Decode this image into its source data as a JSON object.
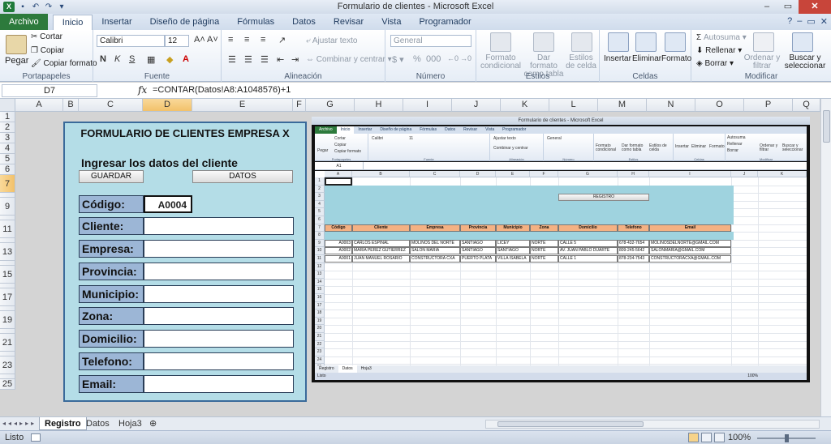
{
  "window": {
    "title": "Formulario de clientes - Microsoft Excel",
    "app_icon": "X"
  },
  "ribbon_tabs": [
    "Archivo",
    "Inicio",
    "Insertar",
    "Diseño de página",
    "Fórmulas",
    "Datos",
    "Revisar",
    "Vista",
    "Programador"
  ],
  "ribbon": {
    "clipboard": {
      "paste": "Pegar",
      "cut": "Cortar",
      "copy": "Copiar",
      "format_painter": "Copiar formato",
      "label": "Portapapeles"
    },
    "font": {
      "name": "Calibri",
      "size": "12",
      "bold": "N",
      "italic": "K",
      "underline": "S",
      "label": "Fuente"
    },
    "alignment": {
      "wrap": "Ajustar texto",
      "merge": "Combinar y centrar",
      "label": "Alineación"
    },
    "number": {
      "format": "General",
      "label": "Número"
    },
    "styles": {
      "conditional": "Formato condicional",
      "as_table": "Dar formato como tabla",
      "cell_styles": "Estilos de celda",
      "label": "Estilos"
    },
    "cells": {
      "insert": "Insertar",
      "delete": "Eliminar",
      "format": "Formato",
      "label": "Celdas"
    },
    "editing": {
      "autosum": "Autosuma",
      "fill": "Rellenar",
      "clear": "Borrar",
      "sort": "Ordenar y filtrar",
      "find": "Buscar y seleccionar",
      "label": "Modificar"
    }
  },
  "formula_bar": {
    "name_box": "D7",
    "fx": "fx",
    "formula": "=CONTAR(Datos!A8:A1048576)+1"
  },
  "columns": [
    "A",
    "B",
    "C",
    "D",
    "E",
    "F",
    "G",
    "H",
    "I",
    "J",
    "K",
    "L",
    "M",
    "N",
    "O",
    "P",
    "Q"
  ],
  "rows": [
    "1",
    "2",
    "3",
    "4",
    "5",
    "6",
    "7",
    "8",
    "9",
    "10",
    "11",
    "12",
    "13",
    "14",
    "15",
    "16",
    "17",
    "18",
    "19",
    "20",
    "21",
    "22",
    "23",
    "24",
    "25"
  ],
  "form": {
    "title": "FORMULARIO DE CLIENTES EMPRESA X",
    "subtitle": "Ingresar los datos del cliente",
    "save_button": "GUARDAR",
    "data_button": "DATOS",
    "fields": [
      {
        "label": "Código:",
        "value": "A0004"
      },
      {
        "label": "Cliente:",
        "value": ""
      },
      {
        "label": "Empresa:",
        "value": ""
      },
      {
        "label": "Provincia:",
        "value": ""
      },
      {
        "label": "Municipio:",
        "value": ""
      },
      {
        "label": "Zona:",
        "value": ""
      },
      {
        "label": "Domicilio:",
        "value": ""
      },
      {
        "label": "Telefono:",
        "value": ""
      },
      {
        "label": "Email:",
        "value": ""
      }
    ]
  },
  "inner_screenshot": {
    "title": "Formulario de clientes - Microsoft Excel",
    "tabs": [
      "Archivo",
      "Inicio",
      "Insertar",
      "Diseño de página",
      "Fórmulas",
      "Datos",
      "Revisar",
      "Vista",
      "Programador"
    ],
    "name_box": "A1",
    "ribbon_labels": [
      "Portapapeles",
      "Fuente",
      "Alineación",
      "Número",
      "Estilos",
      "Celdas",
      "Modificar"
    ],
    "ribbon_items": {
      "paste": "Pegar",
      "cut": "Cortar",
      "copy": "Copiar",
      "painter": "Copiar formato",
      "font": "Calibri",
      "size": "11",
      "wrap": "Ajustar texto",
      "merge": "Combinar y centrar",
      "number": "General",
      "conditional": "Formato condicional",
      "as_table": "Dar formato como tabla",
      "cell_styles": "Estilos de celda",
      "insert": "Insertar",
      "delete": "Eliminar",
      "format": "Formato",
      "autosum": "Autosuma",
      "fill": "Rellenar",
      "clear": "Borrar",
      "sort": "Ordenar y filtrar",
      "find": "Buscar y seleccionar"
    },
    "columns": [
      "A",
      "B",
      "C",
      "D",
      "E",
      "F",
      "G",
      "H",
      "I",
      "J",
      "K"
    ],
    "register_button": "REGISTRO",
    "table_headers": [
      "Código",
      "Cliente",
      "Empresa",
      "Provincia",
      "Municipio",
      "Zona",
      "Domicilio",
      "Telefono",
      "Email"
    ],
    "rows": [
      [
        "A0003",
        "CARLOS ESPINAL",
        "MOLINOS DEL NORTE",
        "SANTIAGO",
        "LICEY",
        "NORTE",
        "CALLE 5",
        "678-432-7654",
        "MOLINOSDELNORTE@GMAIL.COM"
      ],
      [
        "A0002",
        "MARIA PEREZ GUTIERREZ",
        "SALON MARIA",
        "SANTIAGO",
        "SANTIAGO",
        "NORTE",
        "AV. JUAN PABLO DUARTE",
        "809-245-5642",
        "SALONMARIA@GMAIL.COM"
      ],
      [
        "A0001",
        "JUAN MANUEL ROSARIO",
        "CONSTRUCTORA CXA",
        "PUERTO PLATA",
        "VILLA ISABELA",
        "NORTE",
        "CALLE 1",
        "878-234-7543",
        "CONSTRUCTORACXA@GMAIL.COM"
      ]
    ],
    "sheets": [
      "Registro",
      "Datos",
      "Hoja3"
    ],
    "status": "Listo",
    "zoom": "100%"
  },
  "sheet_tabs": [
    "Registro",
    "Datos",
    "Hoja3"
  ],
  "status": {
    "ready": "Listo",
    "zoom": "100%",
    "zoom_level": 1.0
  }
}
